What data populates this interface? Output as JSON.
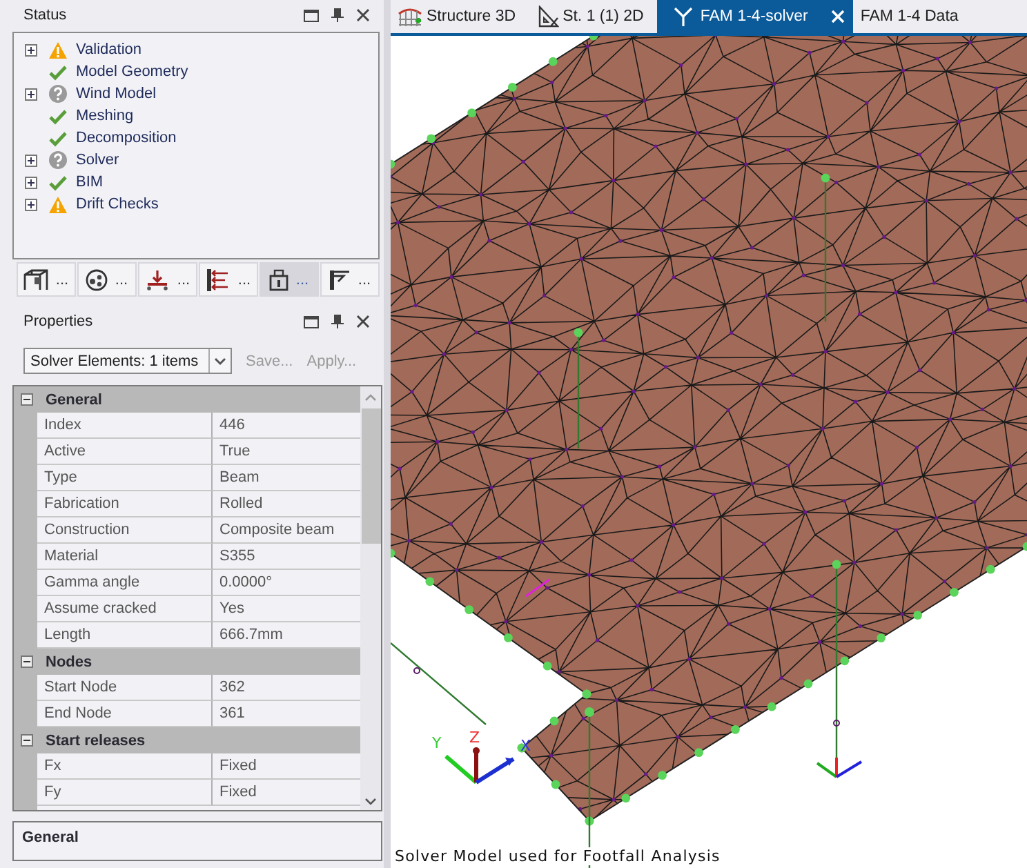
{
  "status_panel": {
    "title": "Status",
    "items": [
      {
        "label": "Validation",
        "kind": "warning",
        "expandable": true,
        "expanded": false
      },
      {
        "label": "Model Geometry",
        "kind": "ok",
        "expandable": false
      },
      {
        "label": "Wind Model",
        "kind": "unknown",
        "expandable": true,
        "expanded": false
      },
      {
        "label": "Meshing",
        "kind": "ok",
        "expandable": false
      },
      {
        "label": "Decomposition",
        "kind": "ok",
        "expandable": false
      },
      {
        "label": "Solver",
        "kind": "unknown",
        "expandable": true,
        "expanded": false
      },
      {
        "label": "BIM",
        "kind": "ok",
        "expandable": true,
        "expanded": false
      },
      {
        "label": "Drift Checks",
        "kind": "warning",
        "expandable": true,
        "expanded": false
      }
    ],
    "toolbar": [
      {
        "label": "...",
        "selected": false
      },
      {
        "label": "...",
        "selected": false
      },
      {
        "label": "...",
        "selected": false
      },
      {
        "label": "...",
        "selected": false
      },
      {
        "label": "...",
        "selected": true
      },
      {
        "label": "...",
        "selected": false
      }
    ]
  },
  "properties_panel": {
    "title": "Properties",
    "selector": "Solver Elements: 1 items",
    "save_button": "Save...",
    "apply_button": "Apply...",
    "categories": [
      {
        "name": "General",
        "expanded": true,
        "rows": [
          {
            "name": "Index",
            "value": "446"
          },
          {
            "name": "Active",
            "value": "True"
          },
          {
            "name": "Type",
            "value": "Beam"
          },
          {
            "name": "Fabrication",
            "value": "Rolled"
          },
          {
            "name": "Construction",
            "value": "Composite beam"
          },
          {
            "name": "Material",
            "value": "S355"
          },
          {
            "name": "Gamma angle",
            "value": "0.0000°"
          },
          {
            "name": "Assume cracked",
            "value": "Yes"
          },
          {
            "name": "Length",
            "value": "666.7mm"
          }
        ]
      },
      {
        "name": "Nodes",
        "expanded": true,
        "rows": [
          {
            "name": "Start Node",
            "value": "362"
          },
          {
            "name": "End Node",
            "value": "361"
          }
        ]
      },
      {
        "name": "Start releases",
        "expanded": true,
        "rows": [
          {
            "name": "Fx",
            "value": "Fixed"
          },
          {
            "name": "Fy",
            "value": "Fixed"
          }
        ]
      }
    ],
    "description": "General"
  },
  "tabs": [
    {
      "label": "Structure 3D",
      "selected": false,
      "closable": false
    },
    {
      "label": "St. 1 (1) 2D",
      "selected": false,
      "closable": false
    },
    {
      "label": "FAM 1-4-solver",
      "selected": true,
      "closable": true
    },
    {
      "label": "FAM 1-4 Data",
      "selected": false,
      "closable": false
    }
  ],
  "viewport": {
    "axes": {
      "x": "X",
      "y": "Y",
      "z": "Z"
    },
    "caption": "Solver Model used for Footfall Analysis"
  }
}
